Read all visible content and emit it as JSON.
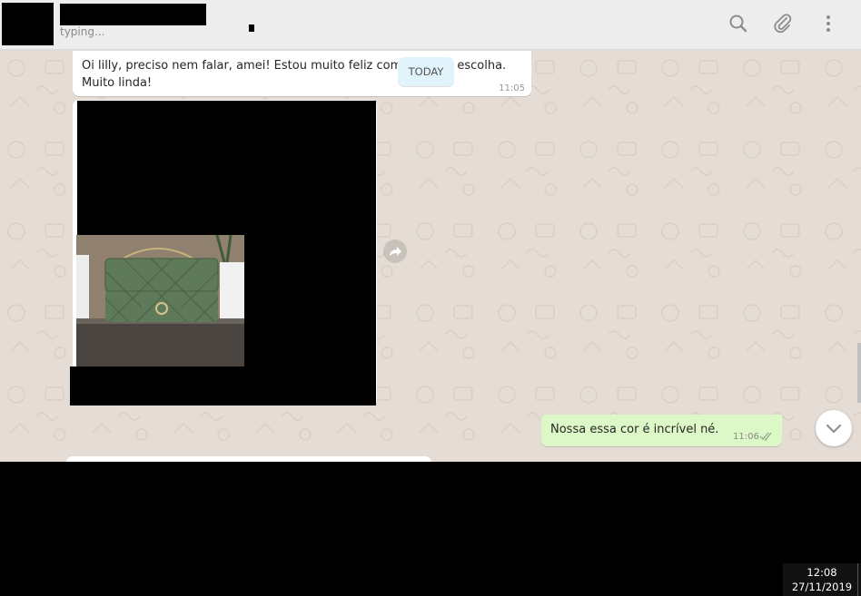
{
  "header": {
    "status": "typing..."
  },
  "messages": {
    "incoming_text": "Oi lilly, preciso nem falar, amei! Estou muito feliz com a minha escolha. Muito linda!",
    "incoming_time": "11:05",
    "date_chip": "TODAY",
    "outgoing_text": "Nossa essa cor é incrível né.",
    "outgoing_time": "11:06"
  },
  "taskbar": {
    "time": "12:08",
    "date": "27/11/2019"
  },
  "colors": {
    "chat_bg": "#e5ddd5",
    "outgoing_bubble": "#dcf8c6",
    "incoming_bubble": "#ffffff",
    "date_chip_bg": "#e1f3fb",
    "tick_color": "#92a58c",
    "bag_color": "#5e7a58"
  },
  "icons": [
    "search-icon",
    "paperclip-icon",
    "more-vertical-icon",
    "forward-icon",
    "double-check-icon",
    "chevron-down-icon"
  ]
}
